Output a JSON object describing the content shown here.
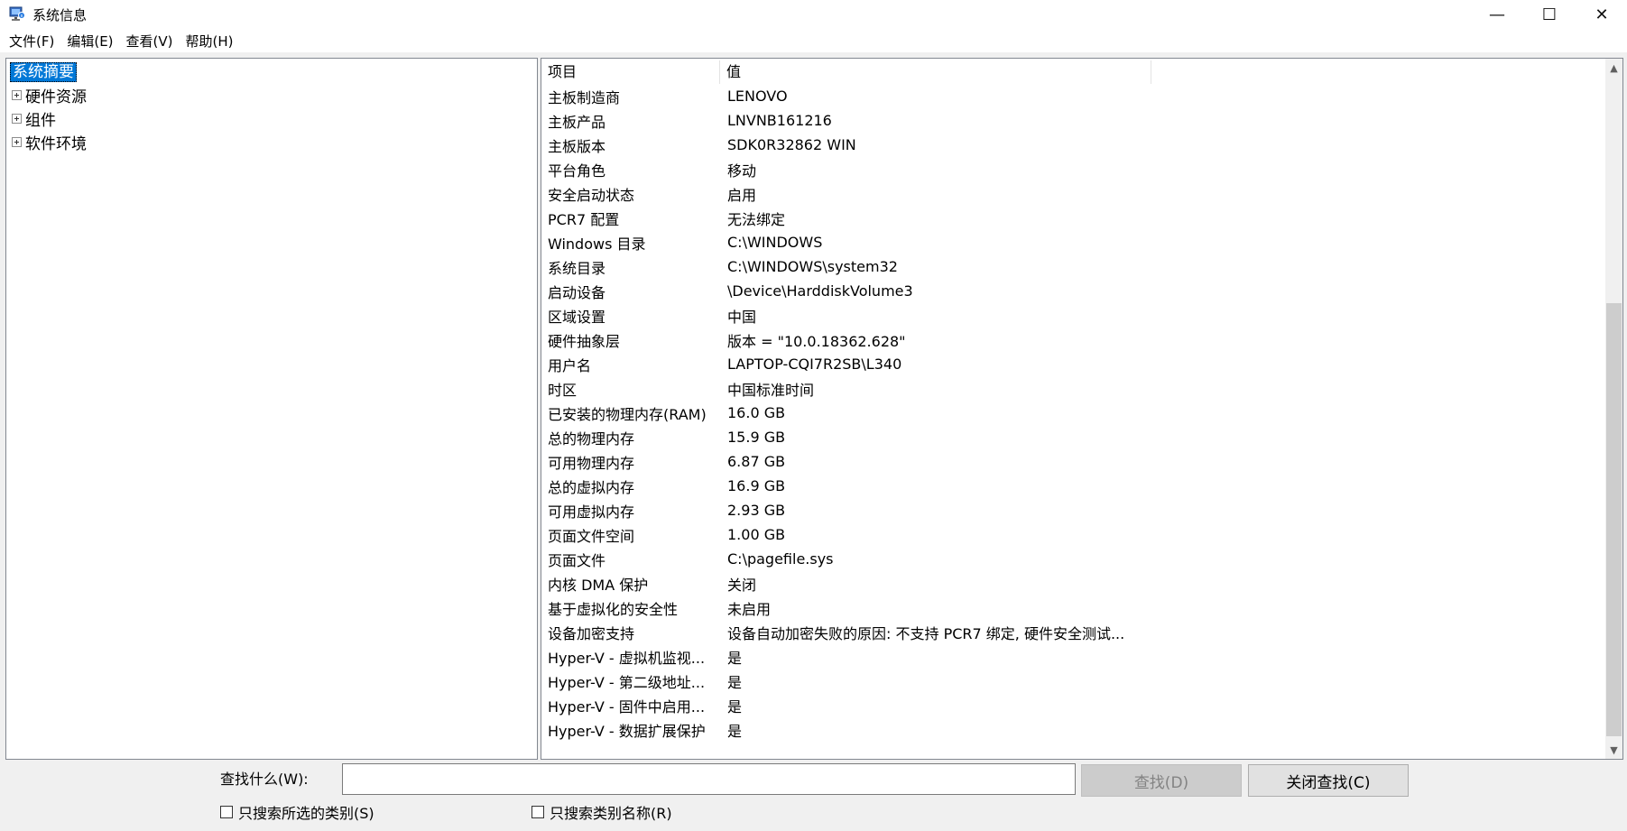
{
  "window": {
    "title": "系统信息",
    "controls": {
      "minimize": "—",
      "maximize": "☐",
      "close": "✕"
    }
  },
  "menu": [
    "文件(F)",
    "编辑(E)",
    "查看(V)",
    "帮助(H)"
  ],
  "tree": {
    "root": "系统摘要",
    "nodes": [
      "硬件资源",
      "组件",
      "软件环境"
    ]
  },
  "table": {
    "headers": {
      "item": "项目",
      "value": "值"
    },
    "rows": [
      {
        "item": "主板制造商",
        "value": "LENOVO"
      },
      {
        "item": "主板产品",
        "value": "LNVNB161216"
      },
      {
        "item": "主板版本",
        "value": "SDK0R32862 WIN"
      },
      {
        "item": "平台角色",
        "value": "移动"
      },
      {
        "item": "安全启动状态",
        "value": "启用"
      },
      {
        "item": "PCR7 配置",
        "value": "无法绑定"
      },
      {
        "item": "Windows 目录",
        "value": "C:\\WINDOWS"
      },
      {
        "item": "系统目录",
        "value": "C:\\WINDOWS\\system32"
      },
      {
        "item": "启动设备",
        "value": "\\Device\\HarddiskVolume3"
      },
      {
        "item": "区域设置",
        "value": "中国"
      },
      {
        "item": "硬件抽象层",
        "value": "版本 = \"10.0.18362.628\""
      },
      {
        "item": "用户名",
        "value": "LAPTOP-CQI7R2SB\\L340"
      },
      {
        "item": "时区",
        "value": "中国标准时间"
      },
      {
        "item": "已安装的物理内存(RAM)",
        "value": "16.0 GB"
      },
      {
        "item": "总的物理内存",
        "value": "15.9 GB"
      },
      {
        "item": "可用物理内存",
        "value": "6.87 GB"
      },
      {
        "item": "总的虚拟内存",
        "value": "16.9 GB"
      },
      {
        "item": "可用虚拟内存",
        "value": "2.93 GB"
      },
      {
        "item": "页面文件空间",
        "value": "1.00 GB"
      },
      {
        "item": "页面文件",
        "value": "C:\\pagefile.sys"
      },
      {
        "item": "内核 DMA 保护",
        "value": "关闭"
      },
      {
        "item": "基于虚拟化的安全性",
        "value": "未启用"
      },
      {
        "item": "设备加密支持",
        "value": "设备自动加密失败的原因: 不支持 PCR7 绑定, 硬件安全测试..."
      },
      {
        "item": "Hyper-V - 虚拟机监视...",
        "value": "是"
      },
      {
        "item": "Hyper-V - 第二级地址...",
        "value": "是"
      },
      {
        "item": "Hyper-V - 固件中启用...",
        "value": "是"
      },
      {
        "item": "Hyper-V - 数据扩展保护",
        "value": "是"
      }
    ]
  },
  "scrollbar": {
    "up_arrow": "▲",
    "down_arrow": "▼"
  },
  "find": {
    "label": "查找什么(W):",
    "input_value": "",
    "find_button": "查找(D)",
    "close_button": "关闭查找(C)",
    "checkbox_selected_category": "只搜索所选的类别(S)",
    "checkbox_category_names": "只搜索类别名称(R)"
  }
}
